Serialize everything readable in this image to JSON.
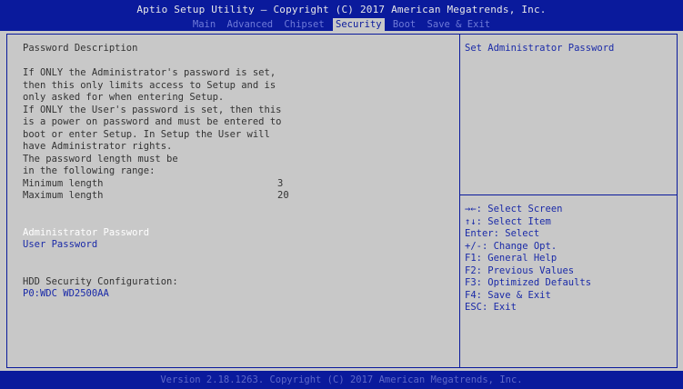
{
  "header": {
    "title": "Aptio Setup Utility – Copyright (C) 2017 American Megatrends, Inc.",
    "tabs": [
      {
        "label": "Main",
        "active": false
      },
      {
        "label": "Advanced",
        "active": false
      },
      {
        "label": "Chipset",
        "active": false
      },
      {
        "label": "Security",
        "active": true
      },
      {
        "label": "Boot",
        "active": false
      },
      {
        "label": "Save & Exit",
        "active": false
      }
    ]
  },
  "description": {
    "heading": "Password Description",
    "lines": [
      "If ONLY the Administrator's password is set,",
      "then this only limits access to Setup and is",
      "only asked for when entering Setup.",
      "If ONLY the User's password is set, then this",
      "is a power on password and must be entered to",
      "boot or enter Setup. In Setup the User will",
      "have Administrator rights.",
      "The password length must be",
      "in the following range:"
    ],
    "min_label": "Minimum length",
    "min_value": "3",
    "max_label": "Maximum length",
    "max_value": "20"
  },
  "menu": {
    "admin_password": "Administrator Password",
    "user_password": "User Password",
    "hdd_heading": "HDD Security Configuration:",
    "hdd_device": "P0:WDC WD2500AA"
  },
  "help_text": "Set Administrator Password",
  "keys": [
    "→←: Select Screen",
    "↑↓: Select Item",
    "Enter: Select",
    "+/-: Change Opt.",
    "F1: General Help",
    "F2: Previous Values",
    "F3: Optimized Defaults",
    "F4: Save & Exit",
    "ESC: Exit"
  ],
  "footer": "Version 2.18.1263. Copyright (C) 2017 American Megatrends, Inc.",
  "colors": {
    "background_blue": "#0a1a9c",
    "panel_gray": "#c8c8c8",
    "text_dark": "#333333",
    "link_blue": "#1a2aa8",
    "selected_white": "#ffffff"
  }
}
